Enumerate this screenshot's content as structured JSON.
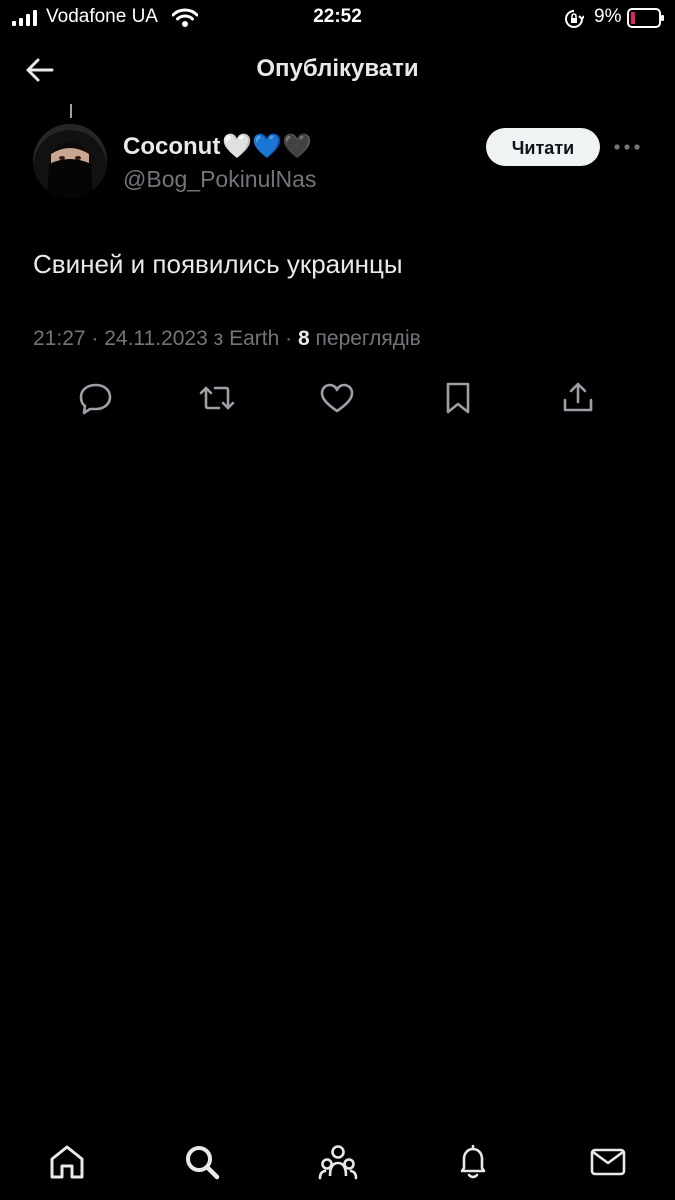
{
  "status_bar": {
    "carrier": "Vodafone UA",
    "time": "22:52",
    "battery": "9%"
  },
  "header": {
    "title": "Опублікувати",
    "back_icon": "arrow-left-icon"
  },
  "tweet": {
    "display_name": "Coconut",
    "name_emoji": "🤍💙🖤",
    "handle": "@Bog_PokinulNas",
    "follow_label": "Читати",
    "text": "Свиней и появились украинцы",
    "time": "21:27",
    "date": "24.11.2023",
    "source_prefix": "з",
    "source": "Earth",
    "views_count": "8",
    "views_label": "переглядів"
  },
  "actions": [
    "reply-icon",
    "retweet-icon",
    "like-icon",
    "bookmark-icon",
    "share-icon"
  ],
  "tab_bar": [
    "home-icon",
    "search-icon",
    "communities-icon",
    "notifications-icon",
    "messages-icon"
  ],
  "colors": {
    "background": "#000000",
    "primary_text": "#e7e9ea",
    "secondary_text": "#71767b",
    "follow_button_bg": "#eff3f4",
    "battery_low": "#e0245e"
  }
}
